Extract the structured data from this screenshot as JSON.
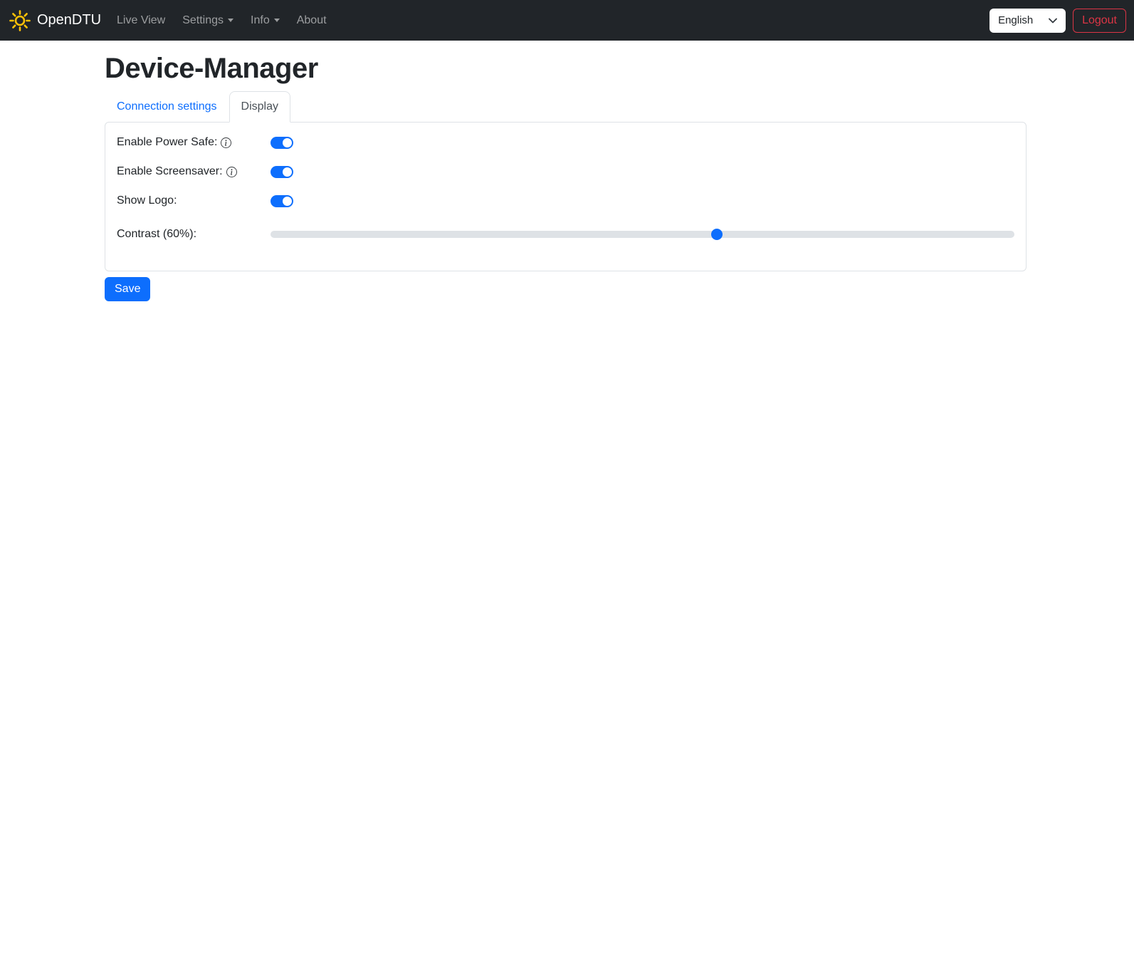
{
  "navbar": {
    "brand": "OpenDTU",
    "items": [
      {
        "label": "Live View",
        "dropdown": false
      },
      {
        "label": "Settings",
        "dropdown": true
      },
      {
        "label": "Info",
        "dropdown": true
      },
      {
        "label": "About",
        "dropdown": false
      }
    ],
    "language_selector": {
      "selected": "English"
    },
    "logout_label": "Logout"
  },
  "page": {
    "title": "Device-Manager"
  },
  "tabs": [
    {
      "label": "Connection settings",
      "active": false
    },
    {
      "label": "Display",
      "active": true
    }
  ],
  "form": {
    "fields": [
      {
        "label": "Enable Power Safe:",
        "type": "toggle",
        "value": true,
        "has_info": true
      },
      {
        "label": "Enable Screensaver:",
        "type": "toggle",
        "value": true,
        "has_info": true
      },
      {
        "label": "Show Logo:",
        "type": "toggle",
        "value": true,
        "has_info": false
      },
      {
        "label": "Contrast (60%):",
        "type": "slider",
        "value": 60,
        "min": 0,
        "max": 100
      }
    ],
    "save_label": "Save"
  },
  "colors": {
    "primary": "#0d6efd",
    "danger": "#dc3545",
    "navbar_bg": "#212529",
    "border": "#dee2e6",
    "sun": "#ffc107",
    "link": "#0d6efd"
  }
}
